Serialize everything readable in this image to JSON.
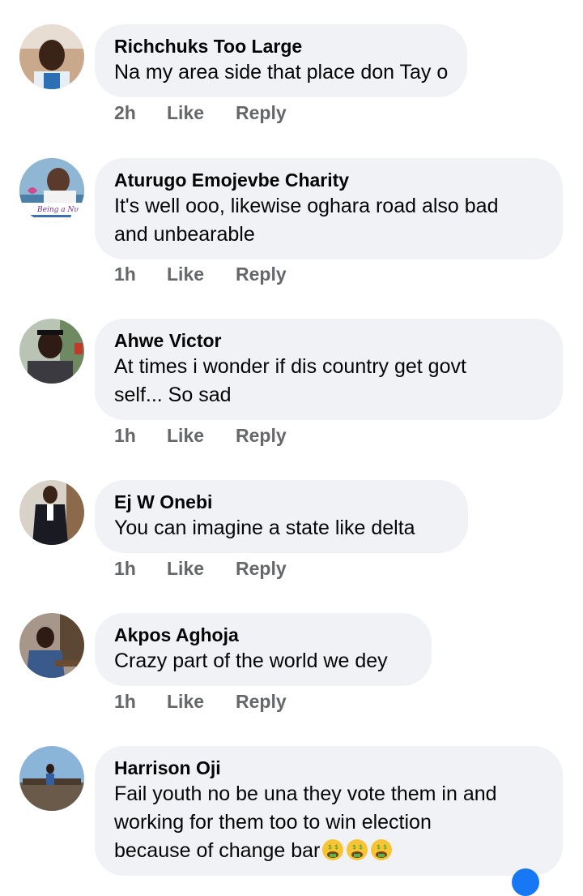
{
  "comments": [
    {
      "author": "Richchuks Too Large",
      "text": "Na my area side that place don Tay o",
      "time": "2h",
      "like": "Like",
      "reply": "Reply",
      "avatar": "profile-photo"
    },
    {
      "author": "Aturugo Emojevbe Charity",
      "text": "It's well ooo, likewise oghara road also bad\nand unbearable",
      "time": "1h",
      "like": "Like",
      "reply": "Reply",
      "avatar": "profile-photo"
    },
    {
      "author": "Ahwe Victor",
      "text": "At times i wonder if dis country get govt\nself... So sad",
      "time": "1h",
      "like": "Like",
      "reply": "Reply",
      "avatar": "profile-photo"
    },
    {
      "author": "Ej W Onebi",
      "text": "You can imagine a state like delta",
      "time": "1h",
      "like": "Like",
      "reply": "Reply",
      "avatar": "profile-photo"
    },
    {
      "author": "Akpos Aghoja",
      "text": "Crazy part of the world we dey",
      "time": "1h",
      "like": "Like",
      "reply": "Reply",
      "avatar": "profile-photo"
    },
    {
      "author": "Harrison Oji",
      "text": "Fail youth no be una they vote them in and\nworking for them too to win election\nbecause of change bar",
      "emoji": [
        "money-mouth-face-icon",
        "money-mouth-face-icon",
        "money-mouth-face-icon"
      ]
    }
  ],
  "colors": {
    "bubble": "#f0f2f5",
    "author": "#050505",
    "meta": "#65676b",
    "accent": "#1877f2"
  }
}
